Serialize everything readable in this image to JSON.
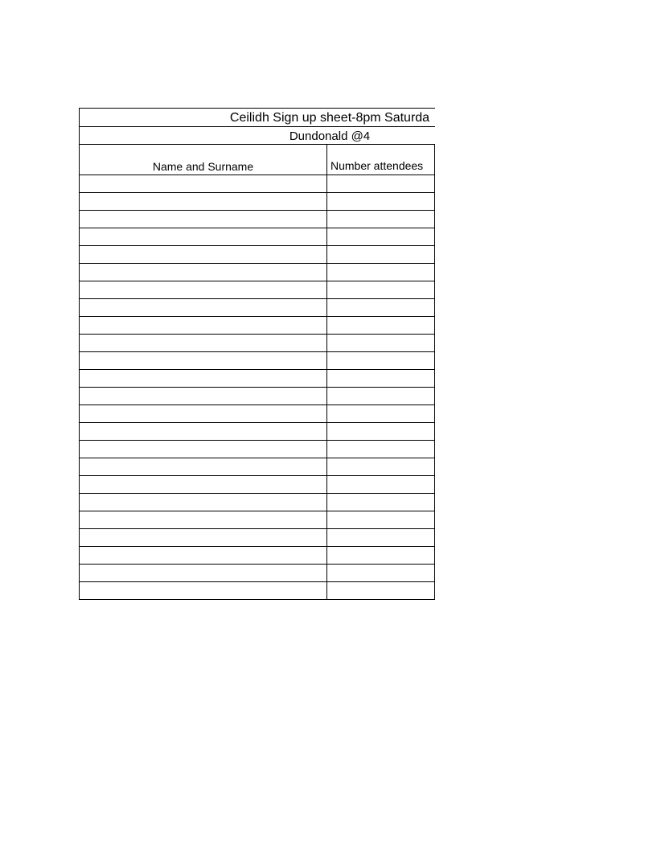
{
  "title": "Ceilidh Sign up sheet-8pm Saturda",
  "subtitle": "Dundonald @4",
  "columns": {
    "name": "Name and Surname",
    "attendees": "Number attendees"
  },
  "rowCount": 24
}
